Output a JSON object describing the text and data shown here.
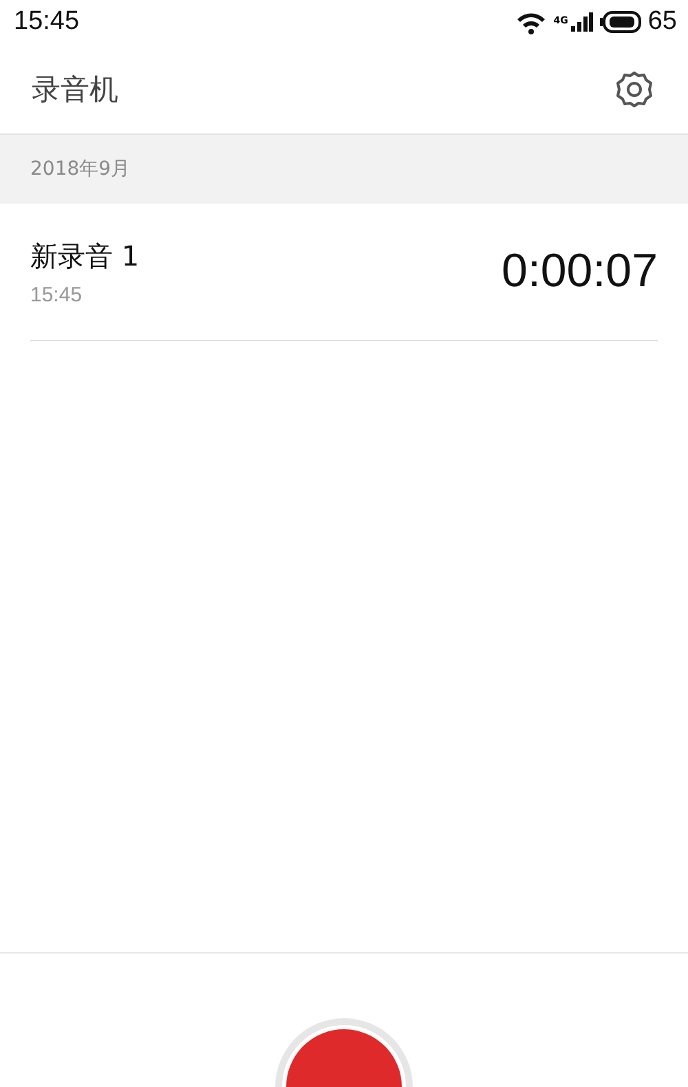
{
  "status_bar": {
    "time": "15:45",
    "network": "4G",
    "battery": "65"
  },
  "header": {
    "title": "录音机"
  },
  "sections": [
    {
      "title": "2018年9月",
      "recordings": [
        {
          "name": "新录音 1",
          "time": "15:45",
          "duration": "0:00:07"
        }
      ]
    }
  ]
}
